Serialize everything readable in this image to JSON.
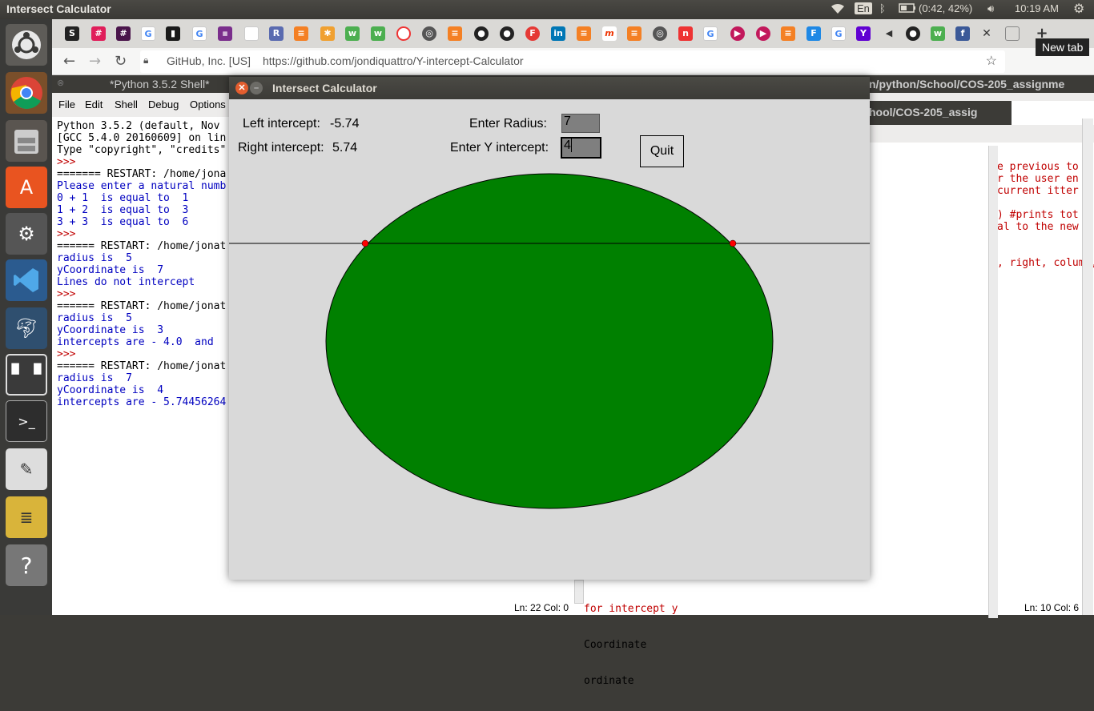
{
  "topbar": {
    "window_title": "Intersect Calculator",
    "keyboard": "En",
    "battery": "(0:42, 42%)",
    "clock": "10:19 AM"
  },
  "browser": {
    "new_tab_tooltip": "New tab",
    "site_identity": "GitHub, Inc. [US]",
    "url": "https://github.com/jondiquattro/Y-intercept-Calculator"
  },
  "idle": {
    "shell_title": "*Python 3.5.2 Shell*",
    "path_title": "n/python/School/COS-205_assignme",
    "path_title2": "hool/COS-205_assig",
    "menu": [
      "File",
      "Edit",
      "Shell",
      "Debug",
      "Options"
    ],
    "shell_lines": [
      {
        "t": "Python 3.5.2 (default, Nov",
        "c": "blk"
      },
      {
        "t": "[GCC 5.4.0 20160609] on lin",
        "c": "blk"
      },
      {
        "t": "Type \"copyright\", \"credits\"",
        "c": "blk"
      },
      {
        "t": ">>>",
        "c": "red"
      },
      {
        "t": "======= RESTART: /home/jona",
        "c": "blk"
      },
      {
        "t": "Please enter a natural numb",
        "c": "blu"
      },
      {
        "t": "0 + 1  is equal to  1",
        "c": "blu"
      },
      {
        "t": "1 + 2  is equal to  3",
        "c": "blu"
      },
      {
        "t": "3 + 3  is equal to  6",
        "c": "blu"
      },
      {
        "t": ">>>",
        "c": "red"
      },
      {
        "t": "====== RESTART: /home/jonat",
        "c": "blk"
      },
      {
        "t": "radius is  5",
        "c": "blu"
      },
      {
        "t": "yCoordinate is  7",
        "c": "blu"
      },
      {
        "t": "Lines do not intercept",
        "c": "blu"
      },
      {
        "t": ">>>",
        "c": "red"
      },
      {
        "t": "====== RESTART: /home/jonat",
        "c": "blk"
      },
      {
        "t": "radius is  5",
        "c": "blu"
      },
      {
        "t": "yCoordinate is  3",
        "c": "blu"
      },
      {
        "t": "intercepts are - 4.0  and",
        "c": "blu"
      },
      {
        "t": ">>>",
        "c": "red"
      },
      {
        "t": "====== RESTART: /home/jonat",
        "c": "blk"
      },
      {
        "t": "radius is  7",
        "c": "blu"
      },
      {
        "t": "yCoordinate is  4",
        "c": "blu"
      },
      {
        "t": "intercepts are - 5.74456264",
        "c": "blu"
      }
    ],
    "editor_lines": [
      "e previous to",
      "r the user en",
      "current itter",
      "",
      ") #prints tot",
      "al to the new",
      "",
      "",
      ", right, column,"
    ],
    "bottom_code": [
      "for intercept y",
      "Coordinate",
      "ordinate"
    ],
    "status_left": "Ln: 22   Col: 0",
    "status_right": "Ln: 10   Col: 6"
  },
  "dialog": {
    "title": "Intersect Calculator",
    "left_label": "Left intercept:",
    "left_value": "-5.74",
    "right_label": "Right intercept:",
    "right_value": "5.74",
    "radius_label": "Enter Radius:",
    "radius_value": "7",
    "yint_label": "Enter Y intercept:",
    "yint_value": "4",
    "quit_label": "Quit",
    "circle_color": "#008000",
    "point_color": "#ff0000"
  }
}
